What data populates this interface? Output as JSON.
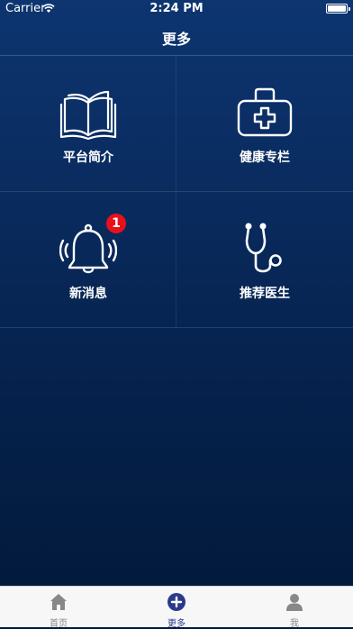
{
  "status_bar": {
    "carrier": "Carrier",
    "time": "2:24 PM"
  },
  "nav": {
    "title": "更多"
  },
  "grid": {
    "items": [
      {
        "label": "平台简介",
        "icon": "book-icon"
      },
      {
        "label": "健康专栏",
        "icon": "medical-kit-icon"
      },
      {
        "label": "新消息",
        "icon": "bell-icon",
        "badge": "1"
      },
      {
        "label": "推荐医生",
        "icon": "stethoscope-icon"
      }
    ]
  },
  "tab_bar": {
    "tabs": [
      {
        "label": "首页",
        "icon": "home-icon"
      },
      {
        "label": "更多",
        "icon": "plus-circle-icon",
        "active": true
      },
      {
        "label": "我",
        "icon": "user-icon"
      }
    ],
    "active_color": "#2b3a8c",
    "inactive_color": "#888888"
  },
  "colors": {
    "badge": "#e8101b",
    "background_top": "#0d3570",
    "background_bottom": "#021a3c"
  }
}
